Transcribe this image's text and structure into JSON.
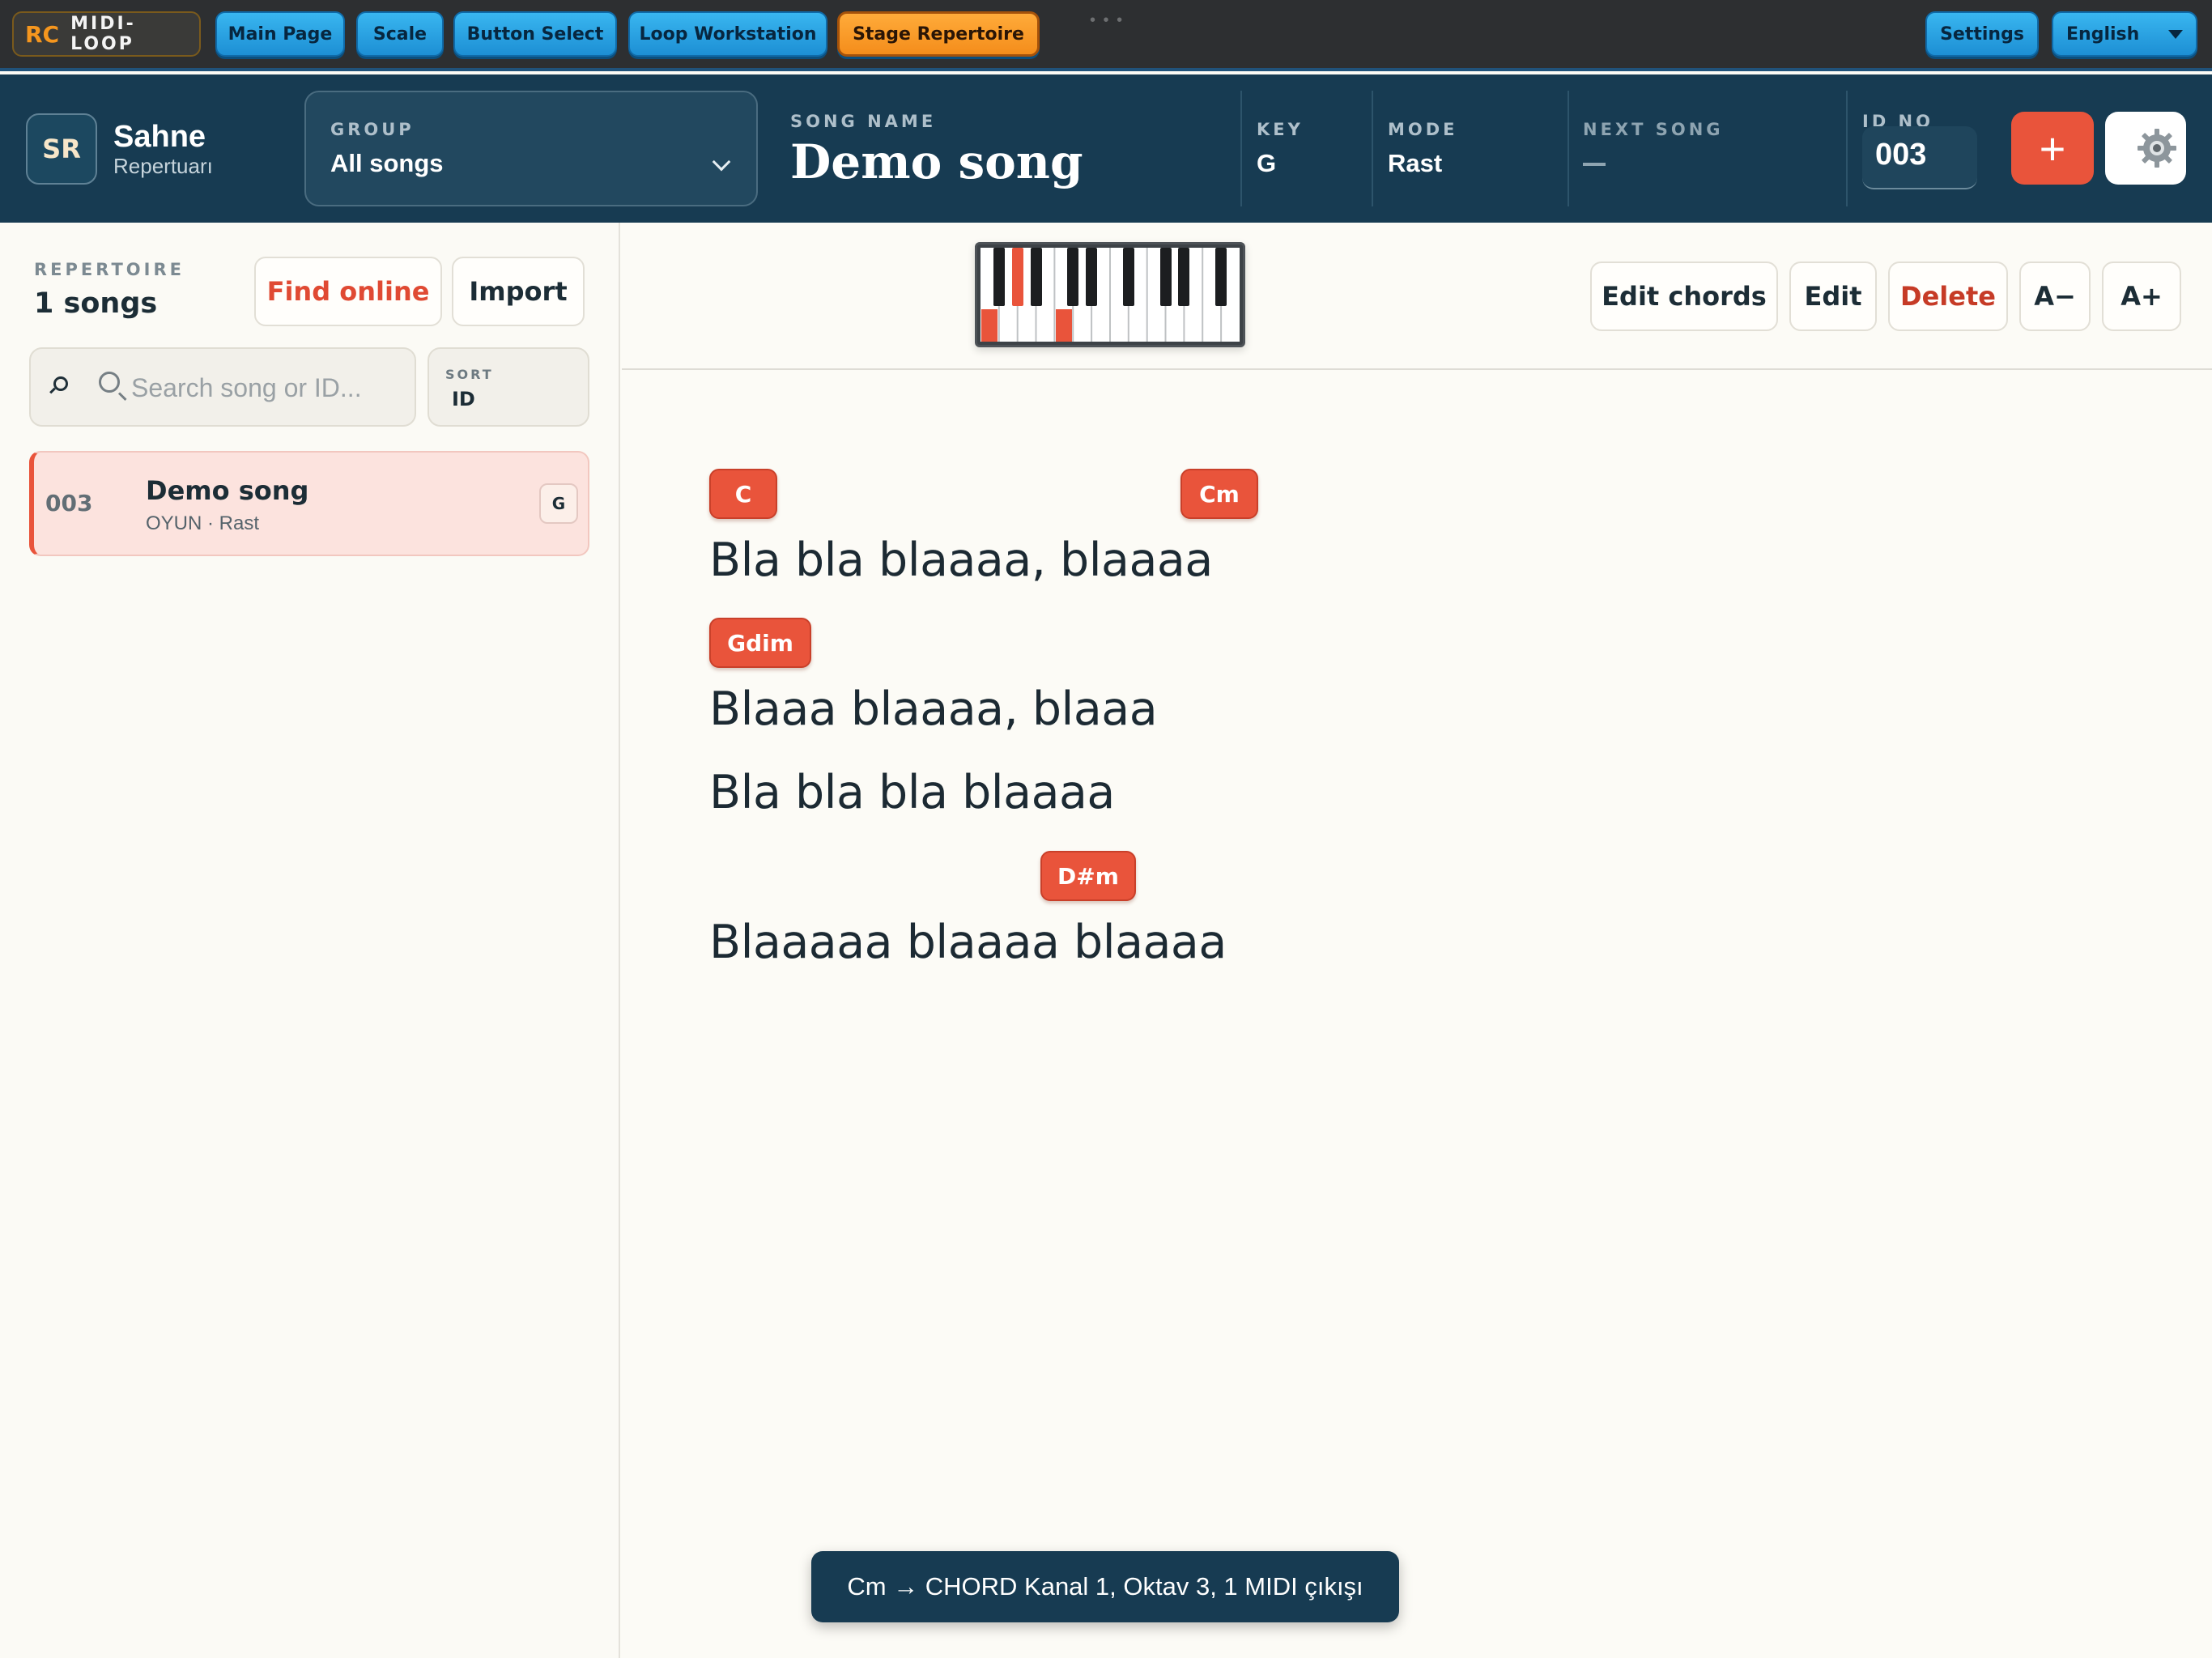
{
  "nav": {
    "logo_mark": "RC",
    "logo_text": "MIDI-LOOP",
    "tabs": [
      {
        "label": "Main Page"
      },
      {
        "label": "Scale"
      },
      {
        "label": "Button Select"
      },
      {
        "label": "Loop Workstation"
      },
      {
        "label": "Stage Repertoire",
        "active": true
      }
    ],
    "settings_label": "Settings",
    "language": "English"
  },
  "header": {
    "badge": "SR",
    "title": "Sahne",
    "subtitle": "Repertuarı",
    "group_label": "GROUP",
    "group_value": "All songs",
    "song_name_label": "SONG NAME",
    "song_name": "Demo song",
    "key_label": "KEY",
    "key_value": "G",
    "mode_label": "MODE",
    "mode_value": "Rast",
    "next_song_label": "NEXT SONG",
    "id_label": "ID NO",
    "id_value": "003",
    "add_label": "+"
  },
  "sidebar": {
    "repertoire_label": "REPERTOIRE",
    "count_text": "1 songs",
    "find_online_label": "Find online",
    "import_label": "Import",
    "search_placeholder": "Search song or ID...",
    "sort_label": "SORT",
    "sort_value": "ID",
    "songs": [
      {
        "id": "003",
        "title": "Demo song",
        "meta": "OYUN · Rast",
        "key": "G"
      }
    ]
  },
  "toolbar": {
    "edit_chords_label": "Edit chords",
    "edit_label": "Edit",
    "delete_label": "Delete",
    "font_smaller_label": "A−",
    "font_larger_label": "A+"
  },
  "lyrics": {
    "chords": [
      "C",
      "Cm",
      "Gdim",
      "D#m"
    ],
    "lines": [
      "Bla bla blaaaa, blaaaa",
      "Blaaa blaaaa, blaaa",
      "Bla bla bla blaaaa",
      "Blaaaaa blaaaa blaaaa"
    ]
  },
  "toast": "Cm → CHORD Kanal 1, Oktav 3, 1 MIDI çıkışı",
  "colors": {
    "accent": "#e9543b",
    "header_bg": "#173b52",
    "nav_button": "#1d8fd4",
    "nav_active": "#f48d1b"
  }
}
